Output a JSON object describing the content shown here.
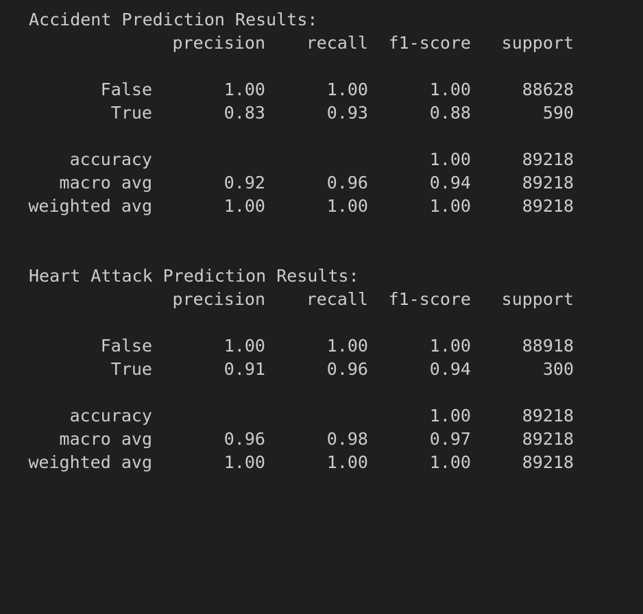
{
  "sections": [
    {
      "title": "Accident Prediction Results:",
      "headers": {
        "precision": "precision",
        "recall": "recall",
        "f1": "f1-score",
        "support": "support"
      },
      "rows": [
        {
          "label": "False",
          "precision": "1.00",
          "recall": "1.00",
          "f1": "1.00",
          "support": "88628"
        },
        {
          "label": "True",
          "precision": "0.83",
          "recall": "0.93",
          "f1": "0.88",
          "support": "590"
        }
      ],
      "summary": [
        {
          "label": "accuracy",
          "precision": "",
          "recall": "",
          "f1": "1.00",
          "support": "89218"
        },
        {
          "label": "macro avg",
          "precision": "0.92",
          "recall": "0.96",
          "f1": "0.94",
          "support": "89218"
        },
        {
          "label": "weighted avg",
          "precision": "1.00",
          "recall": "1.00",
          "f1": "1.00",
          "support": "89218"
        }
      ]
    },
    {
      "title": "Heart Attack Prediction Results:",
      "headers": {
        "precision": "precision",
        "recall": "recall",
        "f1": "f1-score",
        "support": "support"
      },
      "rows": [
        {
          "label": "False",
          "precision": "1.00",
          "recall": "1.00",
          "f1": "1.00",
          "support": "88918"
        },
        {
          "label": "True",
          "precision": "0.91",
          "recall": "0.96",
          "f1": "0.94",
          "support": "300"
        }
      ],
      "summary": [
        {
          "label": "accuracy",
          "precision": "",
          "recall": "",
          "f1": "1.00",
          "support": "89218"
        },
        {
          "label": "macro avg",
          "precision": "0.96",
          "recall": "0.98",
          "f1": "0.97",
          "support": "89218"
        },
        {
          "label": "weighted avg",
          "precision": "1.00",
          "recall": "1.00",
          "f1": "1.00",
          "support": "89218"
        }
      ]
    }
  ]
}
